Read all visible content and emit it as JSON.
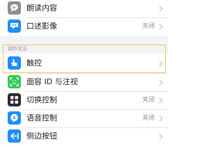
{
  "top_group": {
    "rows": [
      {
        "label": "朗读内容",
        "value": "",
        "icon": "speech-bubble-icon",
        "icon_color": "#8e8e93"
      },
      {
        "label": "口述影像",
        "value": "关闭",
        "icon": "audio-description-icon",
        "icon_color": "#1f8dfb"
      }
    ]
  },
  "interaction_section": {
    "header": "动作交互",
    "rows": [
      {
        "label": "触控",
        "value": "",
        "icon": "hand-touch-icon",
        "icon_color": "#1f8dfb"
      },
      {
        "label": "面容 ID 与注视",
        "value": "",
        "icon": "face-id-icon",
        "icon_color": "#34c759"
      },
      {
        "label": "切换控制",
        "value": "关闭",
        "icon": "switch-control-icon",
        "icon_color": "#2c2c2e"
      },
      {
        "label": "语音控制",
        "value": "关闭",
        "icon": "voice-control-icon",
        "icon_color": "#1f8dfb"
      },
      {
        "label": "侧边按钮",
        "value": "",
        "icon": "side-button-icon",
        "icon_color": "#1f8dfb"
      }
    ]
  },
  "colors": {
    "highlight": "#f2c94c",
    "chevron": "#c7c7cc",
    "label": "#1c1c1e",
    "secondary": "#8e8e93"
  }
}
